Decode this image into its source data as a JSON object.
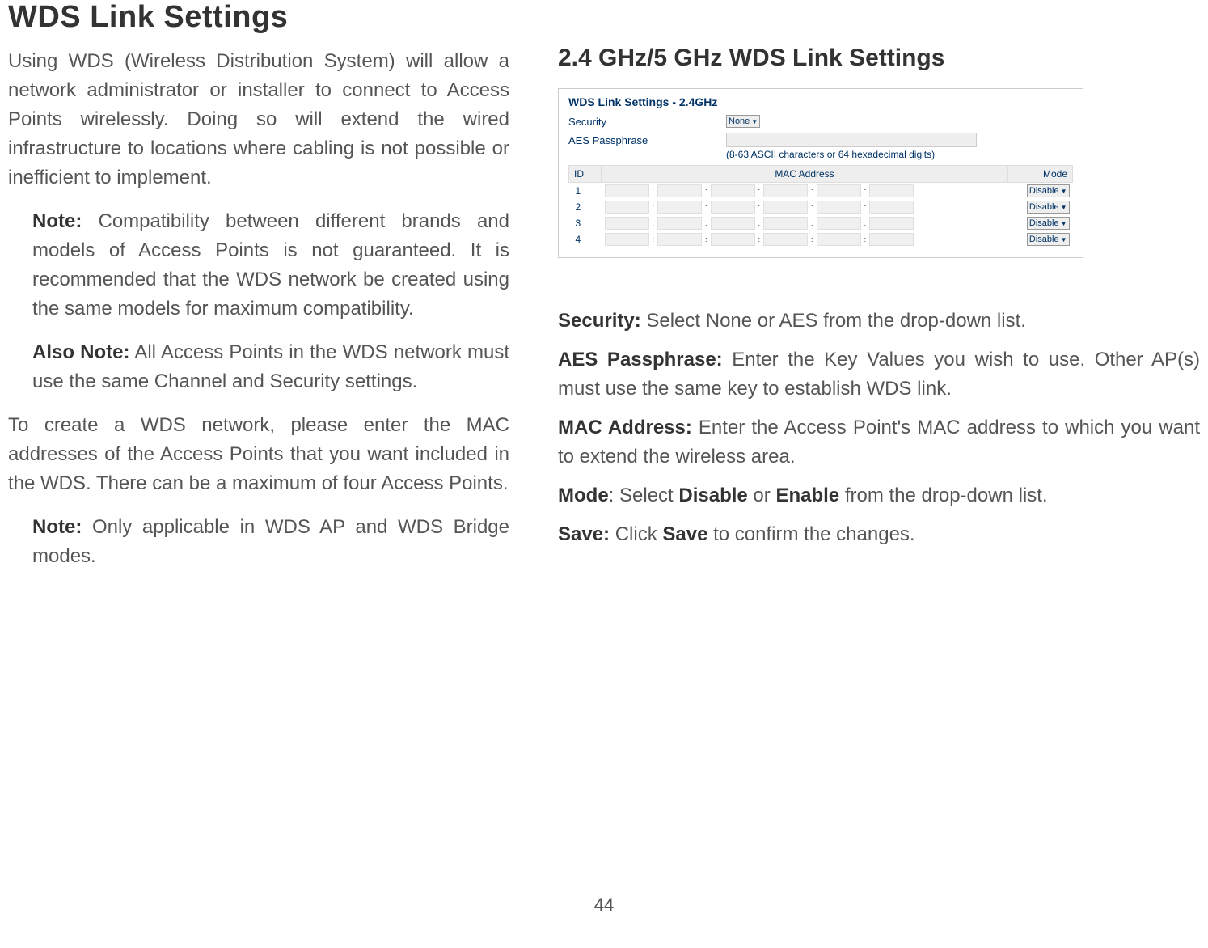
{
  "page_title": "WDS Link Settings",
  "intro_paragraph": "Using WDS (Wireless Distribution System) will allow a network administrator or installer to connect to Access Points wirelessly. Doing so will extend the wired infrastructure to locations where cabling is not possible or inefficient to implement.",
  "note1_label": "Note:",
  "note1_text": " Compatibility between different brands and models of Access Points is not guaranteed. It is recommended that the WDS network be created using the same models for maximum compatibility.",
  "note2_label": "Also Note:",
  "note2_text": " All Access Points in the WDS network must use the same Channel and Security settings.",
  "create_paragraph": "To create a WDS network, please enter the MAC addresses of the Access Points that you want included in the WDS. There can be a maximum of four Access Points.",
  "note3_label": "Note:",
  "note3_text": " Only applicable in WDS AP and WDS Bridge modes.",
  "section_heading": "2.4 GHz/5 GHz WDS Link Settings",
  "panel": {
    "title": "WDS Link Settings - 2.4GHz",
    "security_label": "Security",
    "security_value": "None",
    "passphrase_label": "AES Passphrase",
    "passphrase_hint": "(8-63 ASCII characters or 64 hexadecimal digits)",
    "table": {
      "headers": {
        "id": "ID",
        "mac": "MAC Address",
        "mode": "Mode"
      },
      "rows": [
        {
          "id": "1",
          "mode": "Disable"
        },
        {
          "id": "2",
          "mode": "Disable"
        },
        {
          "id": "3",
          "mode": "Disable"
        },
        {
          "id": "4",
          "mode": "Disable"
        }
      ]
    }
  },
  "definitions": {
    "security_label": "Security:",
    "security_text": " Select None or AES from the drop-down list.",
    "aes_label": "AES Passphrase:",
    "aes_text": " Enter the Key Values you wish to use. Other AP(s) must use the same key to establish WDS link.",
    "mac_label": "MAC Address:",
    "mac_text": " Enter the Access Point's MAC address to which you want to extend the wireless area.",
    "mode_label": "Mode",
    "mode_text_prefix": ": Select ",
    "mode_disable": "Disable",
    "mode_or": " or ",
    "mode_enable": "Enable",
    "mode_text_suffix": " from the drop-down list.",
    "save_label": "Save:",
    "save_text_prefix": " Click ",
    "save_bold": "Save",
    "save_text_suffix": " to confirm the changes."
  },
  "page_number": "44"
}
